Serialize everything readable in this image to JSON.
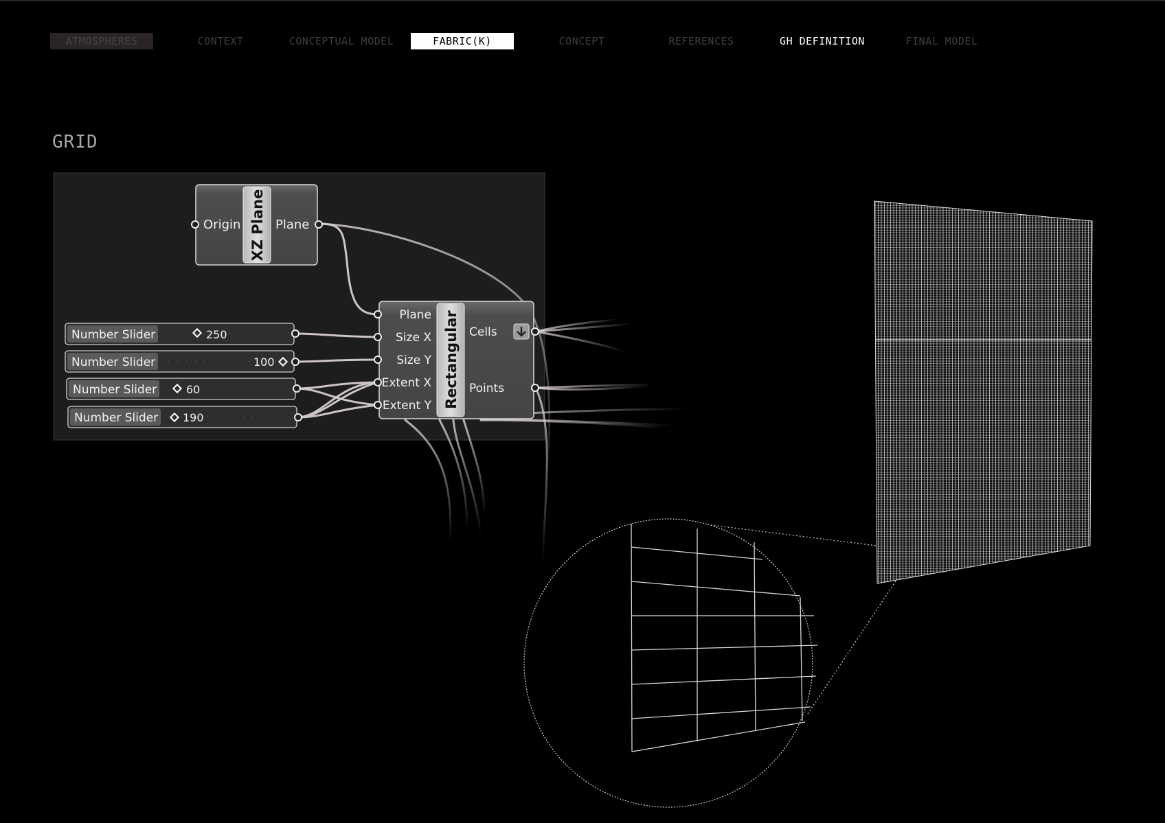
{
  "nav": {
    "tabs": [
      {
        "label": "ATMOSPHERES"
      },
      {
        "label": "CONTEXT"
      },
      {
        "label": "CONCEPTUAL MODEL"
      },
      {
        "label": "FABRIC(K)"
      },
      {
        "label": "CONCEPT"
      },
      {
        "label": "REFERENCES"
      },
      {
        "label": "GH DEFINITION"
      },
      {
        "label": "FINAL MODEL"
      }
    ]
  },
  "section": {
    "title": "GRID"
  },
  "definition": {
    "xz_plane": {
      "title": "XZ Plane",
      "input": "Origin",
      "output": "Plane"
    },
    "rectangular": {
      "title": "Rectangular",
      "inputs": [
        "Plane",
        "Size X",
        "Size Y",
        "Extent X",
        "Extent Y"
      ],
      "outputs": [
        "Cells",
        "Points"
      ]
    },
    "sliders": [
      {
        "label": "Number Slider",
        "value": "250"
      },
      {
        "label": "Number Slider",
        "value": "100"
      },
      {
        "label": "Number Slider",
        "value": "60"
      },
      {
        "label": "Number Slider",
        "value": "190"
      }
    ]
  },
  "colors": {
    "background": "#000000",
    "canvas": "#1c1c1c",
    "component": "#4d4d4d",
    "wire": "#c9bfbf"
  },
  "icons": {
    "cells_flag": "arrow-down-icon",
    "slider_grip": "diamond-icon"
  }
}
